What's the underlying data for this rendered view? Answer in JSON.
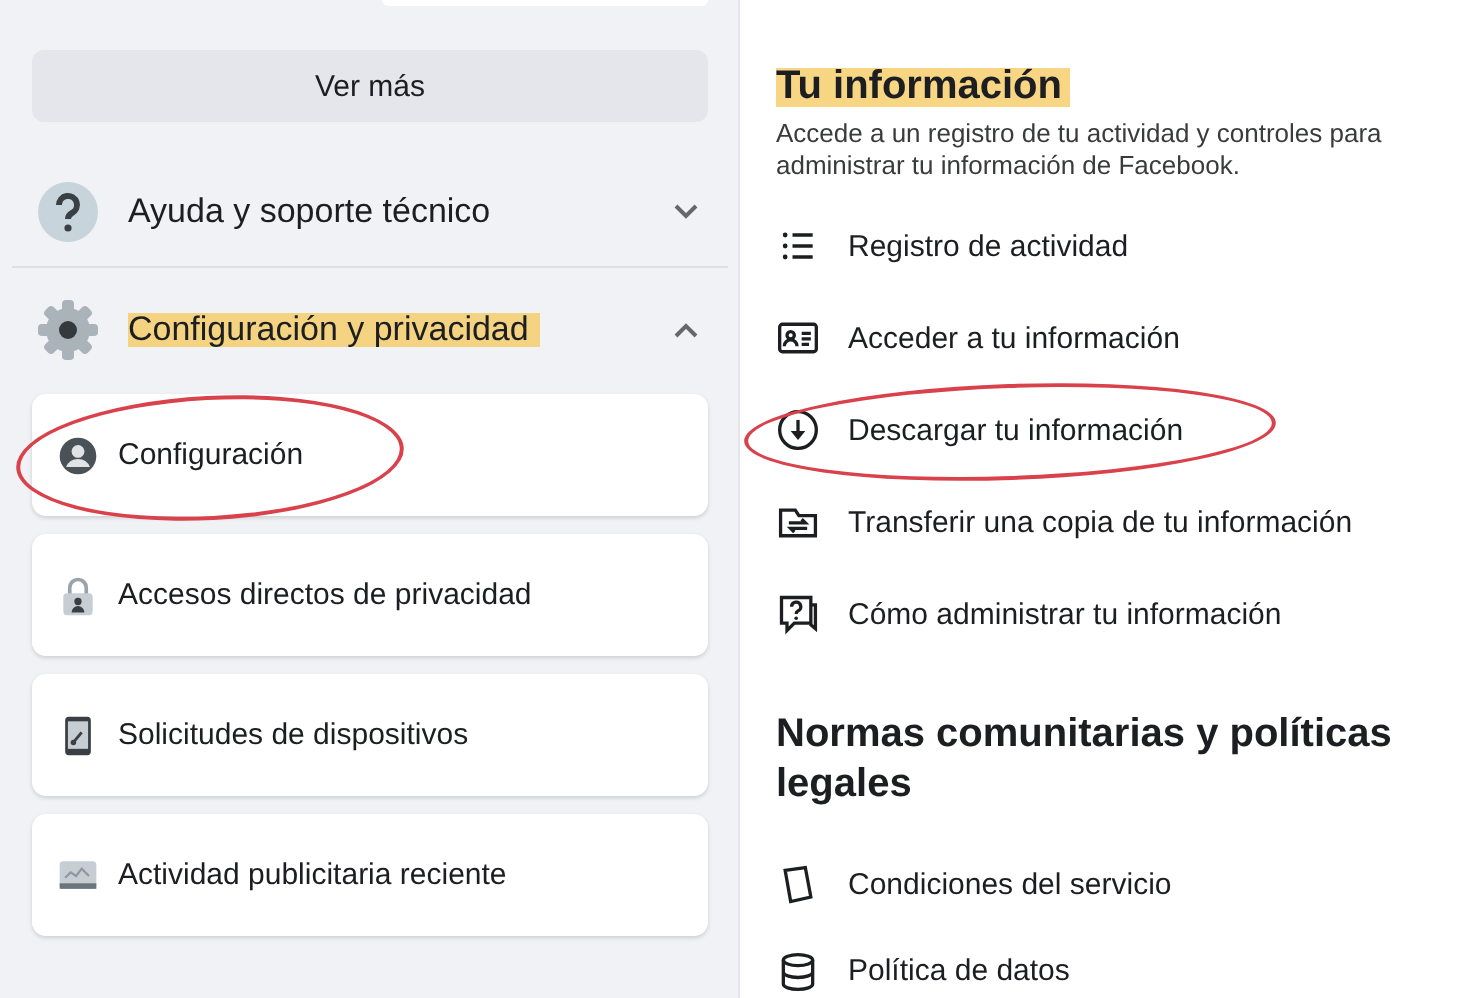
{
  "left_panel": {
    "see_more_button": "Ver más",
    "sections": [
      {
        "label": "Ayuda y soporte técnico",
        "expanded": false,
        "highlighted": false
      },
      {
        "label": "Configuración y privacidad",
        "expanded": true,
        "highlighted": true
      }
    ],
    "items": [
      {
        "label": "Configuración",
        "circled": true
      },
      {
        "label": "Accesos directos de privacidad",
        "circled": false
      },
      {
        "label": "Solicitudes de dispositivos",
        "circled": false
      },
      {
        "label": "Actividad publicitaria reciente",
        "circled": false
      }
    ]
  },
  "right_panel": {
    "your_info": {
      "title": "Tu información",
      "highlighted": true,
      "description": "Accede a un registro de tu actividad y controles para administrar tu información de Facebook.",
      "items": [
        {
          "label": "Registro de actividad",
          "circled": false
        },
        {
          "label": "Acceder a tu información",
          "circled": false
        },
        {
          "label": "Descargar tu información",
          "circled": true
        },
        {
          "label": "Transferir una copia de tu información",
          "circled": false
        },
        {
          "label": "Cómo administrar tu información",
          "circled": false
        }
      ]
    },
    "policies": {
      "title": "Normas comunitarias y políticas legales",
      "items": [
        {
          "label": "Condiciones del servicio"
        },
        {
          "label": "Política de datos"
        }
      ]
    }
  }
}
